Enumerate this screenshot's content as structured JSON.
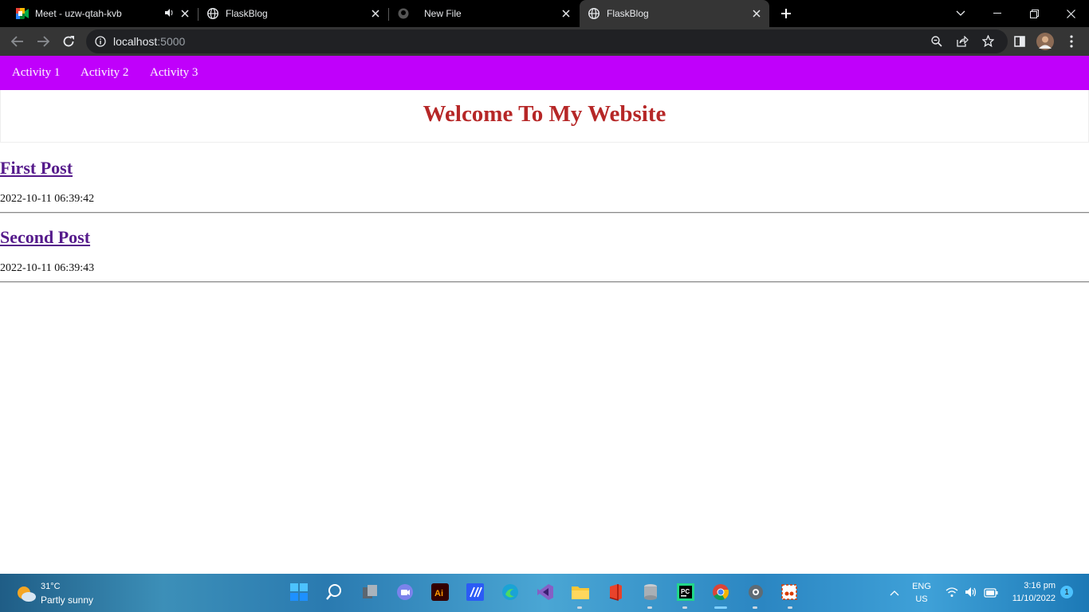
{
  "browser": {
    "tabs": [
      {
        "title": "Meet - uzw-qtah-kvb",
        "favicon": "google-meet-icon",
        "audio": true,
        "active": false
      },
      {
        "title": "FlaskBlog",
        "favicon": "globe-icon",
        "active": false
      },
      {
        "title": "New File",
        "favicon": "github-icon",
        "active": false
      },
      {
        "title": "FlaskBlog",
        "favicon": "globe-icon",
        "active": true
      }
    ],
    "url_host": "localhost",
    "url_port": ":5000"
  },
  "page": {
    "nav": [
      "Activity 1",
      "Activity 2",
      "Activity 3"
    ],
    "heading": "Welcome To My Website",
    "posts": [
      {
        "title": "First Post",
        "date": "2022-10-11 06:39:42"
      },
      {
        "title": "Second Post",
        "date": "2022-10-11 06:39:43"
      }
    ]
  },
  "taskbar": {
    "weather_temp": "31°C",
    "weather_desc": "Partly sunny",
    "apps": [
      "start-icon",
      "search-icon",
      "task-view-icon",
      "teams-icon",
      "illustrator-icon",
      "vs-code-icon",
      "edge-icon",
      "visual-studio-icon",
      "file-explorer-icon",
      "office-icon",
      "database-icon",
      "pycharm-icon",
      "chrome-icon",
      "settings-icon",
      "snipping-tool-icon"
    ],
    "lang_top": "ENG",
    "lang_bottom": "US",
    "time": "3:16 pm",
    "date": "11/10/2022",
    "notifications": "1"
  },
  "colors": {
    "navbar": "#c000fb",
    "heading": "#b62727",
    "link": "#551a8b"
  }
}
